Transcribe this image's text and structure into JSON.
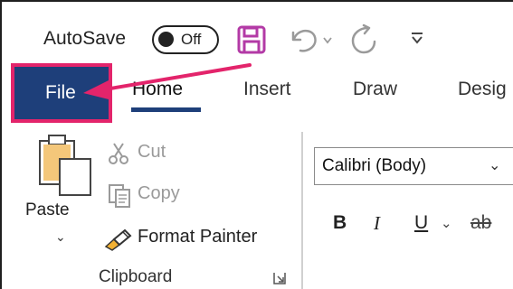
{
  "quick_access": {
    "autosave_label": "AutoSave",
    "autosave_state": "Off",
    "icons": [
      "save-icon",
      "undo-icon",
      "undo-dropdown-icon",
      "redo-icon",
      "customize-toolbar-icon"
    ]
  },
  "tabs": [
    {
      "label": "File",
      "highlighted": true
    },
    {
      "label": "Home",
      "active": true
    },
    {
      "label": "Insert"
    },
    {
      "label": "Draw"
    },
    {
      "label": "Desig"
    }
  ],
  "clipboard": {
    "paste_label": "Paste",
    "cut_label": "Cut",
    "copy_label": "Copy",
    "format_painter_label": "Format Painter",
    "group_label": "Clipboard"
  },
  "font": {
    "font_name": "Calibri (Body)",
    "bold": "B",
    "italic": "I",
    "underline": "U",
    "strikethrough": "ab"
  },
  "colors": {
    "file_tab_bg": "#1e3f7a",
    "highlight_border": "#e3246b",
    "arrow": "#e3246b",
    "save_icon": "#b33aa6"
  }
}
